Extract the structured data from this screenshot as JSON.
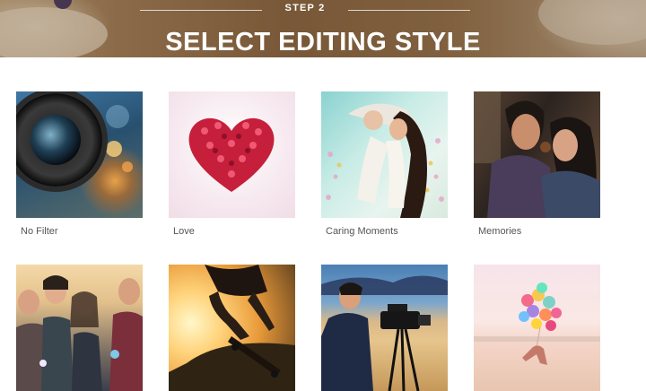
{
  "header": {
    "step_label": "STEP 2",
    "title": "SELECT EDITING STYLE"
  },
  "styles": [
    {
      "label": "No Filter"
    },
    {
      "label": "Love"
    },
    {
      "label": "Caring Moments"
    },
    {
      "label": "Memories"
    },
    {
      "label": ""
    },
    {
      "label": ""
    },
    {
      "label": ""
    },
    {
      "label": ""
    }
  ]
}
